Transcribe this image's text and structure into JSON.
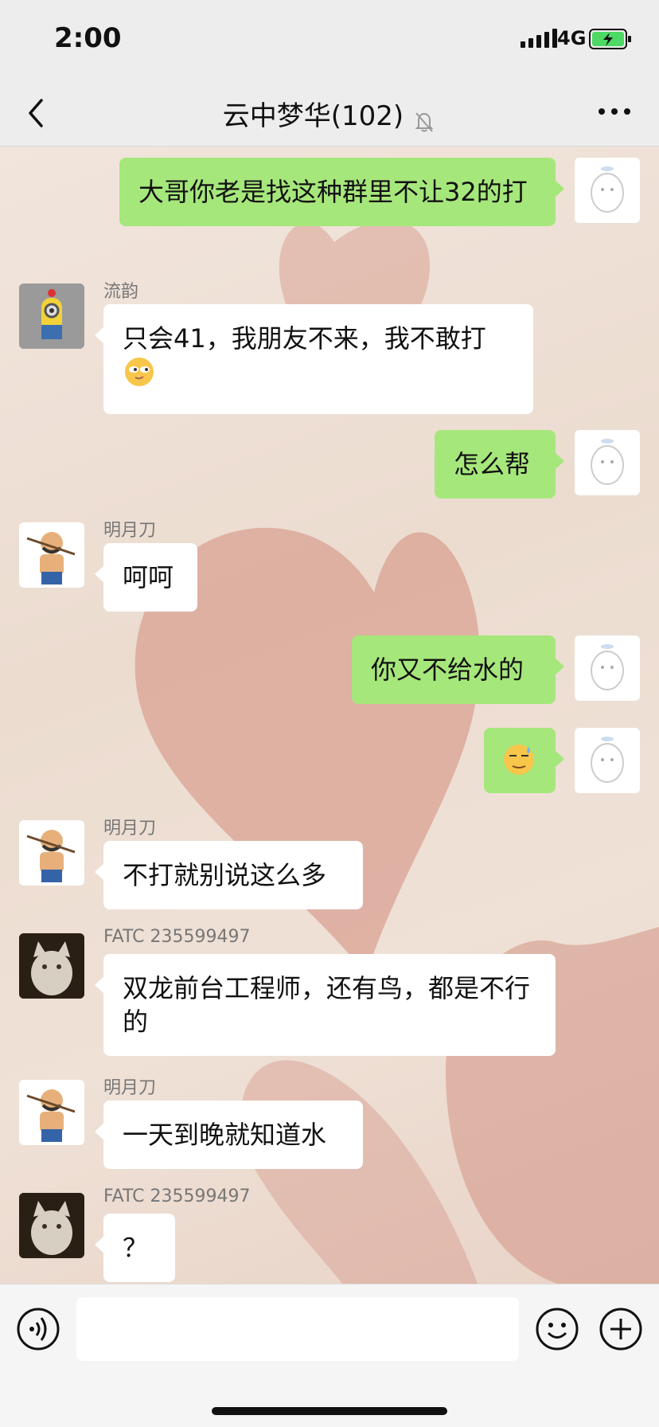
{
  "status_bar": {
    "time": "2:00",
    "network": "4G"
  },
  "header": {
    "title": "云中梦华(102)"
  },
  "messages": [
    {
      "side": "right",
      "text": "大哥你老是找这种群里不让32的打"
    },
    {
      "side": "left",
      "name": "流韵",
      "text": "只会41，我朋友不来，我不敢打"
    },
    {
      "side": "right",
      "text": "怎么帮"
    },
    {
      "side": "left",
      "name": "明月刀",
      "text": "呵呵"
    },
    {
      "side": "right",
      "text": "你又不给水的"
    },
    {
      "side": "right",
      "emoji": "sweat-smile-emoji"
    },
    {
      "side": "left",
      "name": "明月刀",
      "text": "不打就别说这么多"
    },
    {
      "side": "left",
      "name": "FATC 235599497",
      "text": "双龙前台工程师，还有鸟，都是不行的"
    },
    {
      "side": "left",
      "name": "明月刀",
      "text": "一天到晚就知道水"
    },
    {
      "side": "left",
      "name": "FATC 235599497",
      "text": "？"
    }
  ],
  "colors": {
    "bubble_green": "#a6e77b",
    "bubble_white": "#ffffff",
    "nav_bg": "#ededed"
  }
}
